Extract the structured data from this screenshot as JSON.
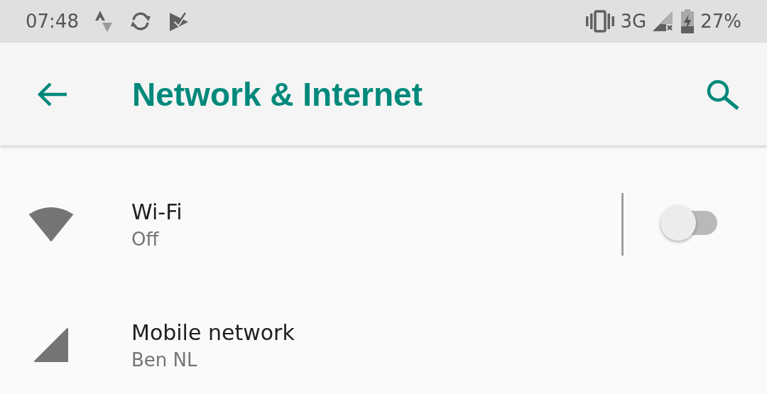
{
  "status_bar": {
    "time": "07:48",
    "network_type": "3G",
    "battery": "27%"
  },
  "app_bar": {
    "title": "Network & Internet"
  },
  "items": [
    {
      "kind": "switch",
      "title": "Wi-Fi",
      "summary": "Off",
      "on": false
    },
    {
      "kind": "plain",
      "title": "Mobile network",
      "summary": "Ben NL"
    }
  ]
}
